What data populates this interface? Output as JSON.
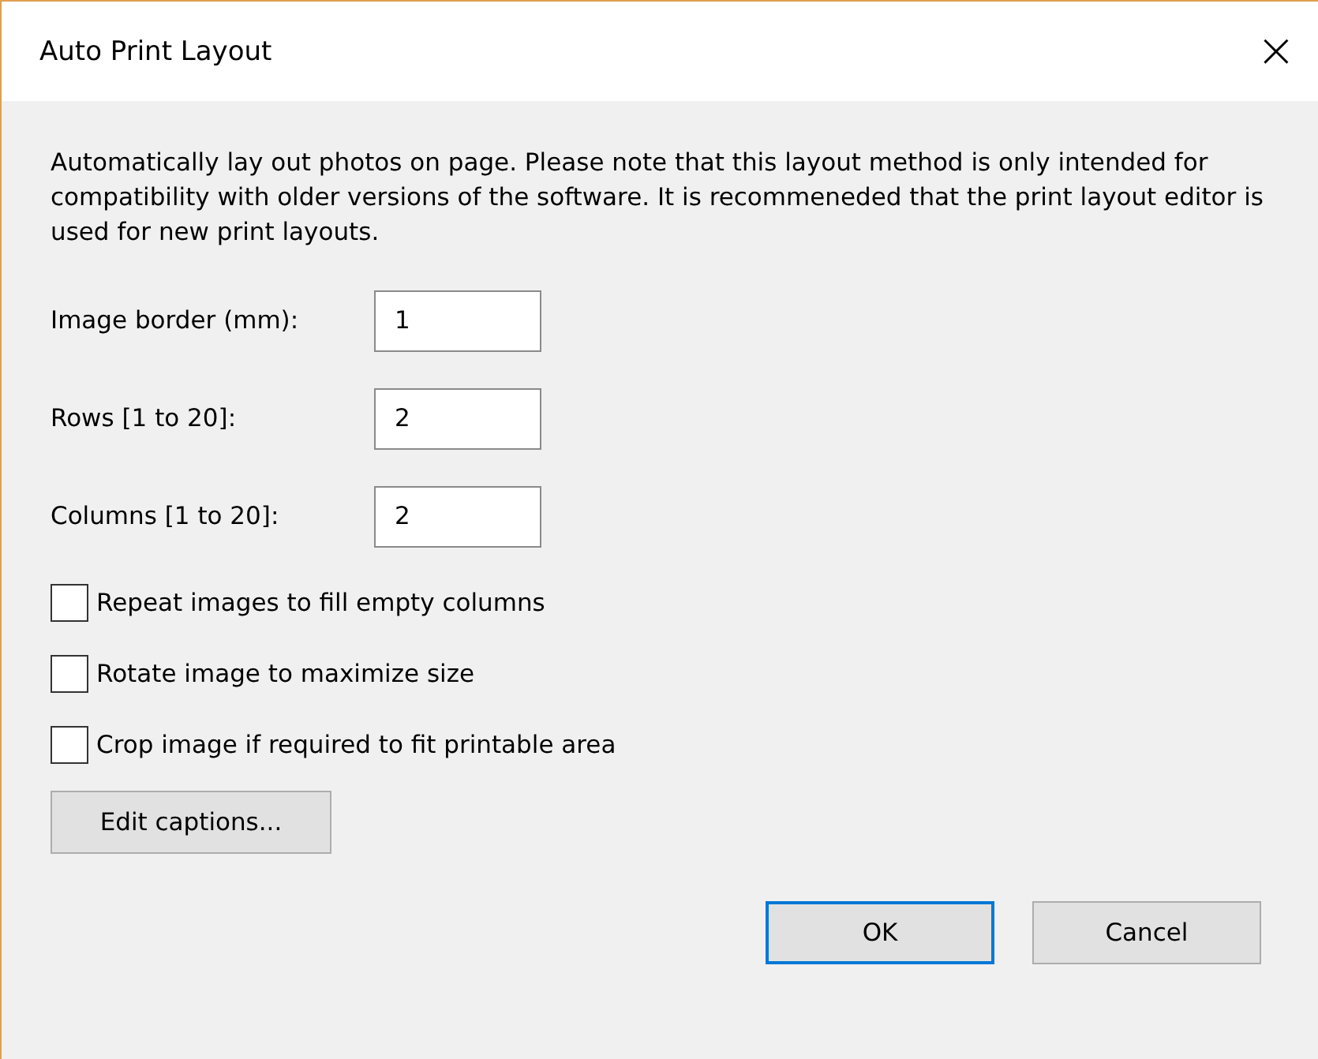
{
  "window": {
    "title": "Auto Print Layout",
    "close": "×"
  },
  "description": "Automatically lay out photos on page. Please note that this layout method is only intended for compatibility with older versions of the software. It is recommeneded that the print layout editor is used for new print layouts.",
  "fields": [
    {
      "label": "Image border (mm):",
      "value": "1"
    },
    {
      "label": "Rows [1 to 20]:",
      "value": "2"
    },
    {
      "label": "Columns [1 to 20]:",
      "value": "2"
    }
  ],
  "options": [
    {
      "label": "Repeat images to fill empty columns",
      "checked": false
    },
    {
      "label": "Rotate image to maximize size",
      "checked": false
    },
    {
      "label": "Crop image if required to fit printable area",
      "checked": false
    }
  ],
  "edit_button": "Edit captions...",
  "buttons": [
    {
      "label": "OK",
      "default": true
    },
    {
      "label": "Cancel",
      "default": false
    }
  ]
}
